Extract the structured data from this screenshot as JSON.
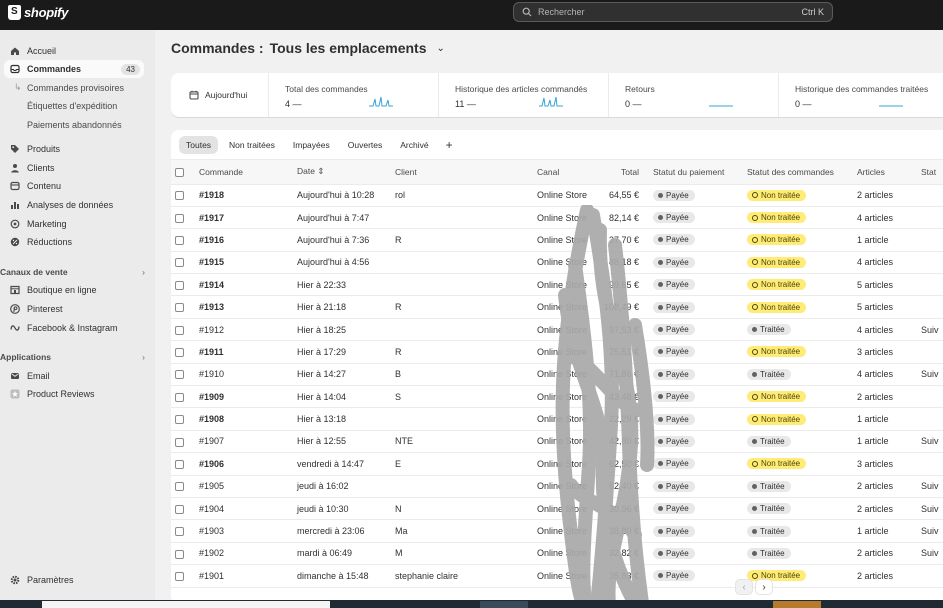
{
  "app": {
    "brand": "shopify"
  },
  "search": {
    "placeholder": "Rechercher",
    "shortcut": "Ctrl K"
  },
  "sidebar": {
    "items": [
      {
        "id": "home",
        "label": "Accueil",
        "icon": "home-icon"
      },
      {
        "id": "orders",
        "label": "Commandes",
        "icon": "inbox-icon",
        "badge": "43",
        "active": true
      },
      {
        "id": "drafts",
        "label": "Commandes provisoires",
        "sub": true
      },
      {
        "id": "labels",
        "label": "Étiquettes d'expédition",
        "sub": true
      },
      {
        "id": "abandoned",
        "label": "Paiements abandonnés",
        "sub": true
      },
      {
        "id": "products",
        "label": "Produits",
        "icon": "tag-icon"
      },
      {
        "id": "customers",
        "label": "Clients",
        "icon": "person-icon"
      },
      {
        "id": "content",
        "label": "Contenu",
        "icon": "content-icon"
      },
      {
        "id": "analytics",
        "label": "Analyses de données",
        "icon": "chart-icon"
      },
      {
        "id": "marketing",
        "label": "Marketing",
        "icon": "target-icon"
      },
      {
        "id": "discounts",
        "label": "Réductions",
        "icon": "discount-icon"
      }
    ],
    "sales_channels": {
      "title": "Canaux de vente",
      "items": [
        {
          "id": "online-store",
          "label": "Boutique en ligne",
          "icon": "store-icon"
        },
        {
          "id": "pinterest",
          "label": "Pinterest",
          "icon": "pinterest-icon"
        },
        {
          "id": "facebook",
          "label": "Facebook & Instagram",
          "icon": "meta-icon"
        }
      ]
    },
    "apps": {
      "title": "Applications",
      "items": [
        {
          "id": "email",
          "label": "Email",
          "icon": "email-icon"
        },
        {
          "id": "reviews",
          "label": "Product Reviews",
          "icon": "star-icon"
        }
      ]
    },
    "settings": {
      "label": "Paramètres",
      "icon": "gear-icon"
    }
  },
  "header": {
    "title": "Commandes :",
    "location": "Tous les emplacements"
  },
  "stats": {
    "date_label": "Aujourd'hui",
    "cards": [
      {
        "label": "Total des commandes",
        "value": "4",
        "dash": "—"
      },
      {
        "label": "Historique des articles commandés",
        "value": "11",
        "dash": "—"
      },
      {
        "label": "Retours",
        "value": "0",
        "dash": "—"
      },
      {
        "label": "Historique des commandes traitées",
        "value": "0",
        "dash": "—"
      }
    ]
  },
  "tabs": [
    "Toutes",
    "Non traitées",
    "Impayées",
    "Ouvertes",
    "Archivé",
    "+"
  ],
  "columns": {
    "order": "Commande",
    "date": "Date",
    "client": "Client",
    "channel": "Canal",
    "total": "Total",
    "payment": "Statut du paiement",
    "fulfillment": "Statut des commandes",
    "items": "Articles",
    "delivery": "Stat"
  },
  "orders": [
    {
      "id": "#1918",
      "bold": true,
      "date": "Aujourd'hui à 10:28",
      "client": "rol",
      "channel": "Online Store",
      "total": "64,55 €",
      "payment": "Payée",
      "status": "Non traitée",
      "unfulfilled": true,
      "articles": "2 articles",
      "delivery": ""
    },
    {
      "id": "#1917",
      "bold": true,
      "date": "Aujourd'hui à 7:47",
      "client": "",
      "channel": "Online Store",
      "total": "82,14 €",
      "payment": "Payée",
      "status": "Non traitée",
      "unfulfilled": true,
      "articles": "4 articles",
      "delivery": ""
    },
    {
      "id": "#1916",
      "bold": true,
      "date": "Aujourd'hui à 7:36",
      "client": "R",
      "channel": "Online Store",
      "total": "37,70 €",
      "payment": "Payée",
      "status": "Non traitée",
      "unfulfilled": true,
      "articles": "1 article",
      "delivery": ""
    },
    {
      "id": "#1915",
      "bold": true,
      "date": "Aujourd'hui à 4:56",
      "client": "",
      "channel": "Online Store",
      "total": "88,18 €",
      "payment": "Payée",
      "status": "Non traitée",
      "unfulfilled": true,
      "articles": "4 articles",
      "delivery": ""
    },
    {
      "id": "#1914",
      "bold": true,
      "date": "Hier à 22:33",
      "client": "",
      "channel": "Online Store",
      "total": "99,65 €",
      "payment": "Payée",
      "status": "Non traitée",
      "unfulfilled": true,
      "articles": "5 articles",
      "delivery": ""
    },
    {
      "id": "#1913",
      "bold": true,
      "date": "Hier à 21:18",
      "client": "R",
      "channel": "Online Store",
      "total": "108,49 €",
      "payment": "Payée",
      "status": "Non traitée",
      "unfulfilled": true,
      "articles": "5 articles",
      "delivery": ""
    },
    {
      "id": "#1912",
      "bold": false,
      "date": "Hier à 18:25",
      "client": "",
      "channel": "Online Store",
      "total": "97,53 €",
      "payment": "Payée",
      "status": "Traitée",
      "unfulfilled": false,
      "articles": "4 articles",
      "delivery": "Suiv"
    },
    {
      "id": "#1911",
      "bold": true,
      "date": "Hier à 17:29",
      "client": "R",
      "channel": "Online Store",
      "total": "75,51 €",
      "payment": "Payée",
      "status": "Non traitée",
      "unfulfilled": true,
      "articles": "3 articles",
      "delivery": ""
    },
    {
      "id": "#1910",
      "bold": false,
      "date": "Hier à 14:27",
      "client": "B",
      "channel": "Online Store",
      "total": "71,86 €",
      "payment": "Payée",
      "status": "Traitée",
      "unfulfilled": false,
      "articles": "4 articles",
      "delivery": "Suiv"
    },
    {
      "id": "#1909",
      "bold": true,
      "date": "Hier à 14:04",
      "client": "S",
      "channel": "Online Store",
      "total": "43,48 €",
      "payment": "Payée",
      "status": "Non traitée",
      "unfulfilled": true,
      "articles": "2 articles",
      "delivery": ""
    },
    {
      "id": "#1908",
      "bold": true,
      "date": "Hier à 13:18",
      "client": "",
      "channel": "Online Store",
      "total": "22,29 €",
      "payment": "Payée",
      "status": "Non traitée",
      "unfulfilled": true,
      "articles": "1 article",
      "delivery": ""
    },
    {
      "id": "#1907",
      "bold": false,
      "date": "Hier à 12:55",
      "client": "NTE",
      "channel": "Online Store",
      "total": "42,80 €",
      "payment": "Payée",
      "status": "Traitée",
      "unfulfilled": false,
      "articles": "1 article",
      "delivery": "Suiv"
    },
    {
      "id": "#1906",
      "bold": true,
      "date": "vendredi à 14:47",
      "client": "E",
      "channel": "Online Store",
      "total": "62,50 €",
      "payment": "Payée",
      "status": "Non traitée",
      "unfulfilled": true,
      "articles": "3 articles",
      "delivery": ""
    },
    {
      "id": "#1905",
      "bold": false,
      "date": "jeudi à 16:02",
      "client": "",
      "channel": "Online Store",
      "total": "62,40 €",
      "payment": "Payée",
      "status": "Traitée",
      "unfulfilled": false,
      "articles": "2 articles",
      "delivery": "Suiv"
    },
    {
      "id": "#1904",
      "bold": false,
      "date": "jeudi à 10:30",
      "client": "N",
      "channel": "Online Store",
      "total": "30,96 €",
      "payment": "Payée",
      "status": "Traitée",
      "unfulfilled": false,
      "articles": "2 articles",
      "delivery": "Suiv"
    },
    {
      "id": "#1903",
      "bold": false,
      "date": "mercredi à 23:06",
      "client": "Ma",
      "channel": "Online Store",
      "total": "38,80 €",
      "payment": "Payée",
      "status": "Traitée",
      "unfulfilled": false,
      "articles": "1 article",
      "delivery": "Suiv"
    },
    {
      "id": "#1902",
      "bold": false,
      "date": "mardi à 06:49",
      "client": "M",
      "channel": "Online Store",
      "total": "32,82 €",
      "payment": "Payée",
      "status": "Traitée",
      "unfulfilled": false,
      "articles": "2 articles",
      "delivery": "Suiv"
    },
    {
      "id": "#1901",
      "bold": false,
      "date": "dimanche à 15:48",
      "client": "stephanie claire",
      "channel": "Online Store",
      "total": "35,83 €",
      "payment": "Payée",
      "status": "Non traitée",
      "unfulfilled": true,
      "articles": "2 articles",
      "delivery": ""
    }
  ],
  "pager": {
    "prev": "‹",
    "next": "›"
  }
}
